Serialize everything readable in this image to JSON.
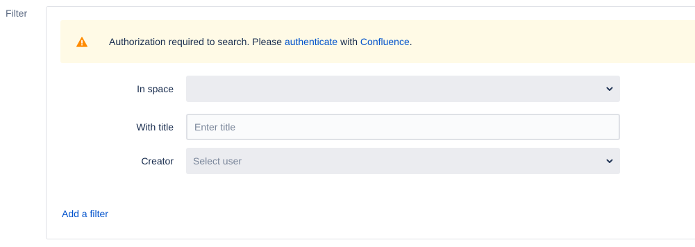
{
  "filter_label": "Filter",
  "warning": {
    "text_before": "Authorization required to search. Please ",
    "link_authenticate": "authenticate",
    "text_middle": " with ",
    "link_confluence": "Confluence",
    "text_after": ".",
    "icon": "warning-icon",
    "icon_color": "#ff8b00",
    "background": "#fffae6"
  },
  "fields": {
    "space": {
      "label": "In space",
      "value": ""
    },
    "title": {
      "label": "With title",
      "value": "",
      "placeholder": "Enter title"
    },
    "creator": {
      "label": "Creator",
      "placeholder": "Select user"
    }
  },
  "add_filter_label": "Add a filter",
  "colors": {
    "link": "#0052cc",
    "select_bg": "#ebecf0",
    "border": "#dfe1e6"
  }
}
